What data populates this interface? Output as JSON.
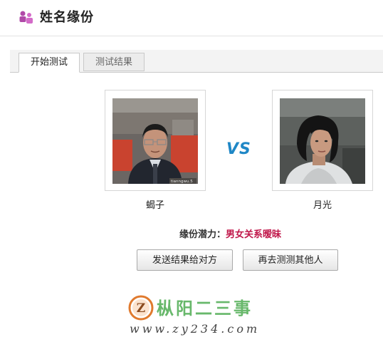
{
  "app": {
    "title": "姓名缘份",
    "icon": "people-icon"
  },
  "tabs": [
    {
      "label": "开始测试",
      "active": true
    },
    {
      "label": "测试结果",
      "active": false
    }
  ],
  "person_left": {
    "name": "蝎子",
    "photo_caption": "tianngwu.5"
  },
  "vs_label": "VS",
  "person_right": {
    "name": "月光"
  },
  "result": {
    "label": "缘份潜力：",
    "value": "男女关系暧昧"
  },
  "buttons": {
    "send": "发送结果给对方",
    "again": "再去测测其他人"
  },
  "watermark": {
    "logo_letter": "Z",
    "name": "枞阳二三事",
    "url": "www.zy234.com"
  },
  "colors": {
    "accent_blue": "#1f87c6",
    "result_red": "#c0174a",
    "watermark_green": "#68b86b"
  }
}
